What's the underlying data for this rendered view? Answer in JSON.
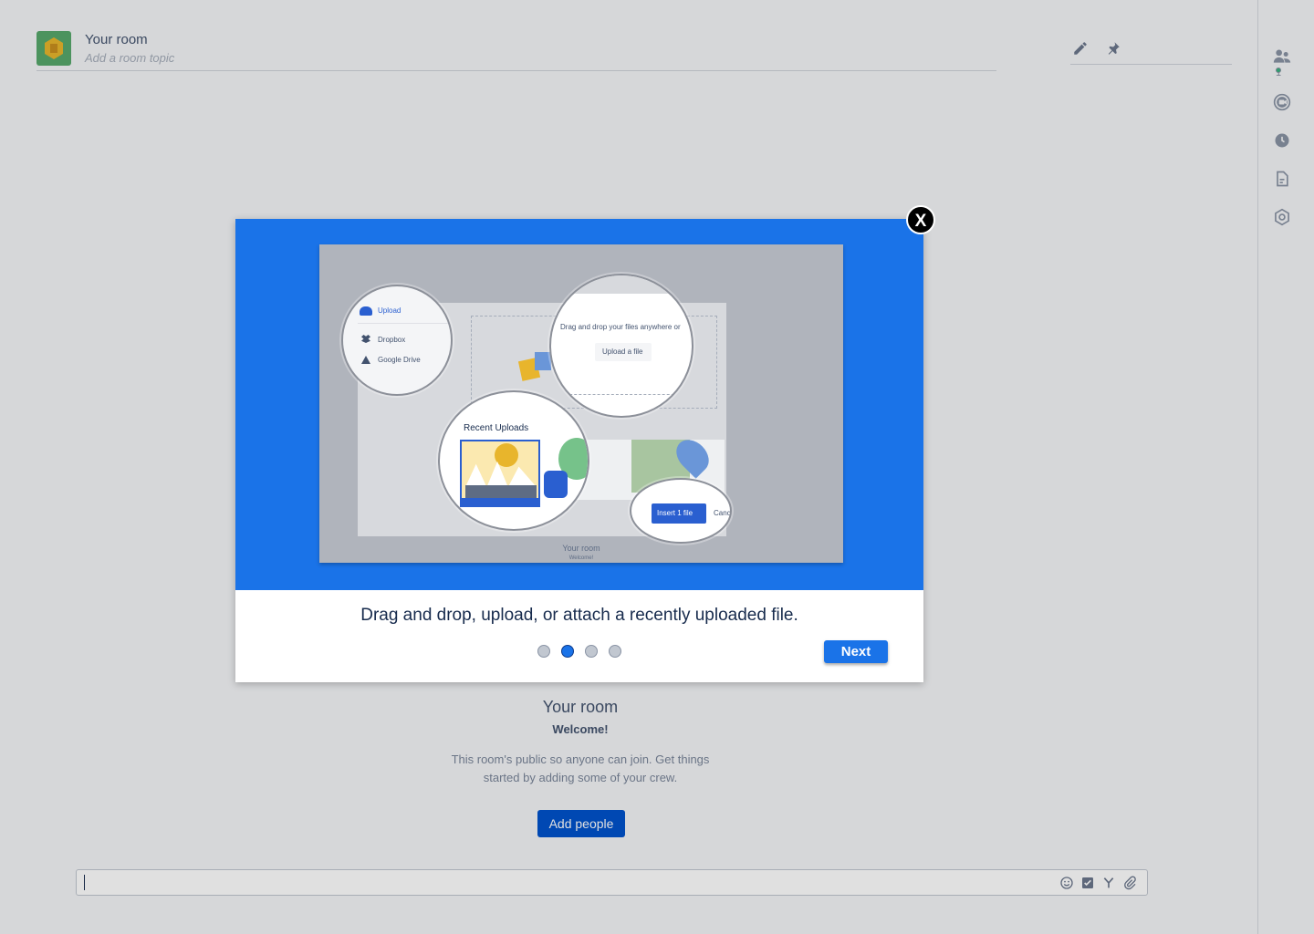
{
  "header": {
    "room_title": "Your room",
    "room_topic": "Add a room topic"
  },
  "sidebar": {
    "people_count": "1"
  },
  "welcome": {
    "title": "Your room",
    "subtitle": "Welcome!",
    "description": "This room's public so anyone can join. Get things started by adding some of your crew.",
    "add_people_label": "Add people"
  },
  "modal": {
    "close_label": "X",
    "description": "Drag and drop, upload, or attach a recently uploaded file.",
    "next_label": "Next",
    "current_step": 2,
    "total_steps": 4,
    "illustration": {
      "upload_label": "Upload",
      "dropbox_label": "Dropbox",
      "google_drive_label": "Google Drive",
      "drag_drop_text": "Drag and drop your files anywhere or",
      "upload_file_label": "Upload a file",
      "recent_uploads_label": "Recent Uploads",
      "insert_label": "Insert 1 file",
      "cancel_label": "Canc",
      "room_caption": "Your room",
      "welcome_caption": "Welcome!"
    }
  },
  "colors": {
    "hero_blue": "#1a73e8",
    "primary_button": "#0052cc",
    "online_dot": "#36b37e"
  }
}
